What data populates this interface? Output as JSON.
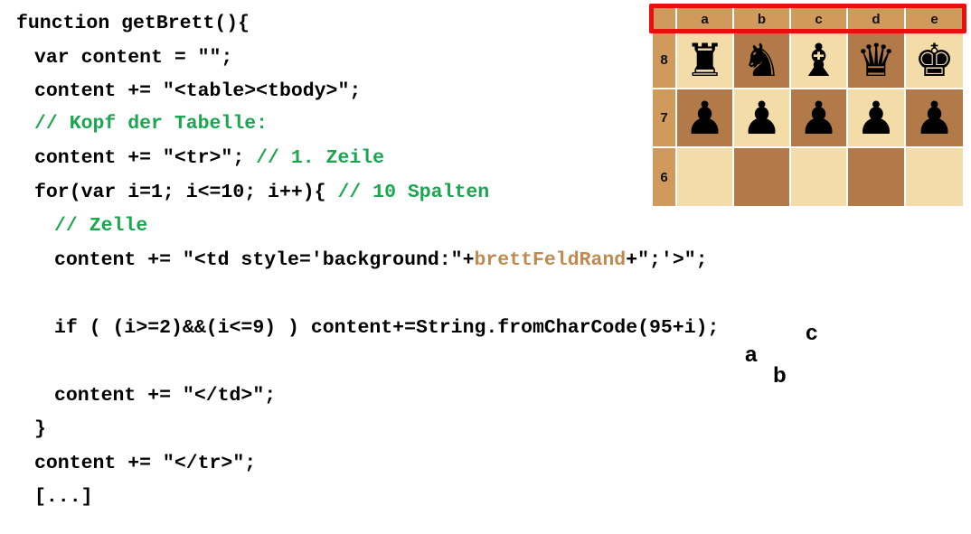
{
  "code": {
    "line1": "function getBrett(){",
    "line2": "var content = \"\";",
    "line3": "content += \"<table><tbody>\";",
    "line4_comment": "// Kopf der Tabelle:",
    "line5_code": "content += \"<tr>\"; ",
    "line5_comment": "// 1. Zeile",
    "line6_code": "for(var i=1; i<=10; i++){ ",
    "line6_comment": "// 10 Spalten",
    "line7_comment": "// Zelle",
    "line8_pre": "content += \"<td style='background:\"+",
    "line8_var": "brettFeldRand",
    "line8_post": "+\";'>\";",
    "line9": "if ( (i>=2)&&(i<=9) ) content+=String.fromCharCode(95+i);",
    "line10": "content += \"</td>\";",
    "line11": "}",
    "line12": "content += \"</tr>\";",
    "line13": "[...]"
  },
  "annotations": {
    "a": "a",
    "b": "b",
    "c": "c"
  },
  "board": {
    "header": [
      "",
      "a",
      "b",
      "c",
      "d",
      "e"
    ],
    "rank_labels": [
      "8",
      "7",
      "6"
    ],
    "rank8": [
      "♜",
      "♞",
      "♝",
      "♛",
      "♚"
    ],
    "rank7": [
      "♟",
      "♟",
      "♟",
      "♟",
      "♟"
    ],
    "rank6": [
      "",
      "",
      "",
      "",
      ""
    ]
  },
  "colors": {
    "comment": "#1aa64e",
    "variable": "#c08a4e",
    "rand": "#d09a5d",
    "light_square": "#f3dca8",
    "dark_square": "#b27a48",
    "highlight": "#e8100c"
  }
}
